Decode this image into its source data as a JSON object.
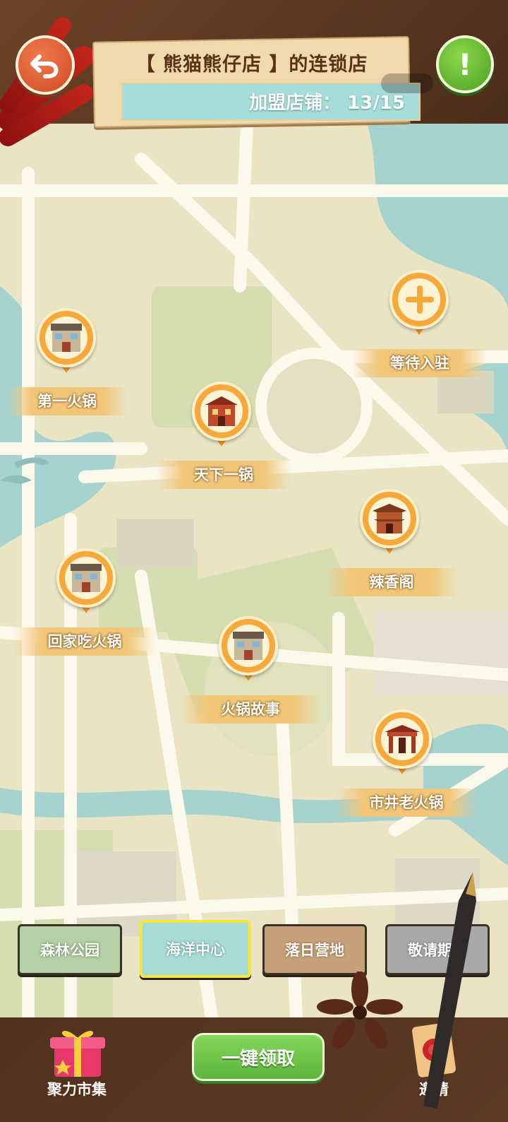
{
  "header": {
    "title": "【 熊猫熊仔店 】的连锁店",
    "franchise_label": "加盟店铺：",
    "franchise_count": "13/15"
  },
  "buttons": {
    "back_icon": "undo-arrow-icon",
    "help_icon": "exclamation-icon",
    "help_text": "!"
  },
  "colors": {
    "map_land": "#e9e4c4",
    "map_park": "#d6ddb0",
    "map_water": "#a7d3cf",
    "map_road": "#fbf8ec",
    "pin_orange": "#f6a93a",
    "accent_green": "#5cb43a"
  },
  "stores": [
    {
      "name": "第一火锅",
      "icon": "shop-building-icon"
    },
    {
      "name": "等待入驻",
      "icon": "plus-icon"
    },
    {
      "name": "天下一锅",
      "icon": "red-restaurant-icon"
    },
    {
      "name": "辣香阁",
      "icon": "pagoda-restaurant-icon"
    },
    {
      "name": "回家吃火锅",
      "icon": "shop-building-icon"
    },
    {
      "name": "火锅故事",
      "icon": "shop-building-icon"
    },
    {
      "name": "市井老火锅",
      "icon": "gate-restaurant-icon"
    }
  ],
  "tabs": [
    {
      "label": "森林公园"
    },
    {
      "label": "海洋中心",
      "selected": true
    },
    {
      "label": "落日营地"
    },
    {
      "label": "敬请期待"
    }
  ],
  "bottom": {
    "market_label": "聚力市集",
    "claim_label": "一键领取",
    "invite_label": "邀请"
  }
}
